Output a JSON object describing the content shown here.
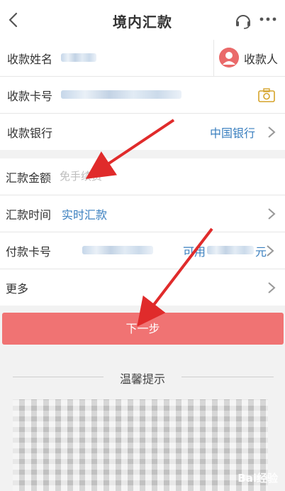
{
  "header": {
    "title": "境内汇款"
  },
  "payee": {
    "name_label": "收款姓名",
    "payee_button_label": "收款人",
    "card_label": "收款卡号",
    "bank_label": "收款银行",
    "bank_value": "中国银行"
  },
  "transfer": {
    "amount_label": "汇款金额",
    "amount_placeholder": "免手续费",
    "time_label": "汇款时间",
    "time_value": "实时汇款",
    "payer_card_label": "付款卡号",
    "available_prefix": "可用",
    "available_suffix": "元",
    "more_label": "更多"
  },
  "next_button_label": "下一步",
  "tips": {
    "title": "温馨提示"
  },
  "watermark": "Bai经验",
  "colors": {
    "accent_red": "#f07373",
    "link_blue": "#3a7fbf",
    "arrow_red": "#e02b2b"
  },
  "icons": [
    "back-icon",
    "headset-icon",
    "more-dots-icon",
    "avatar-icon",
    "camera-icon",
    "chevron-right-icon"
  ]
}
